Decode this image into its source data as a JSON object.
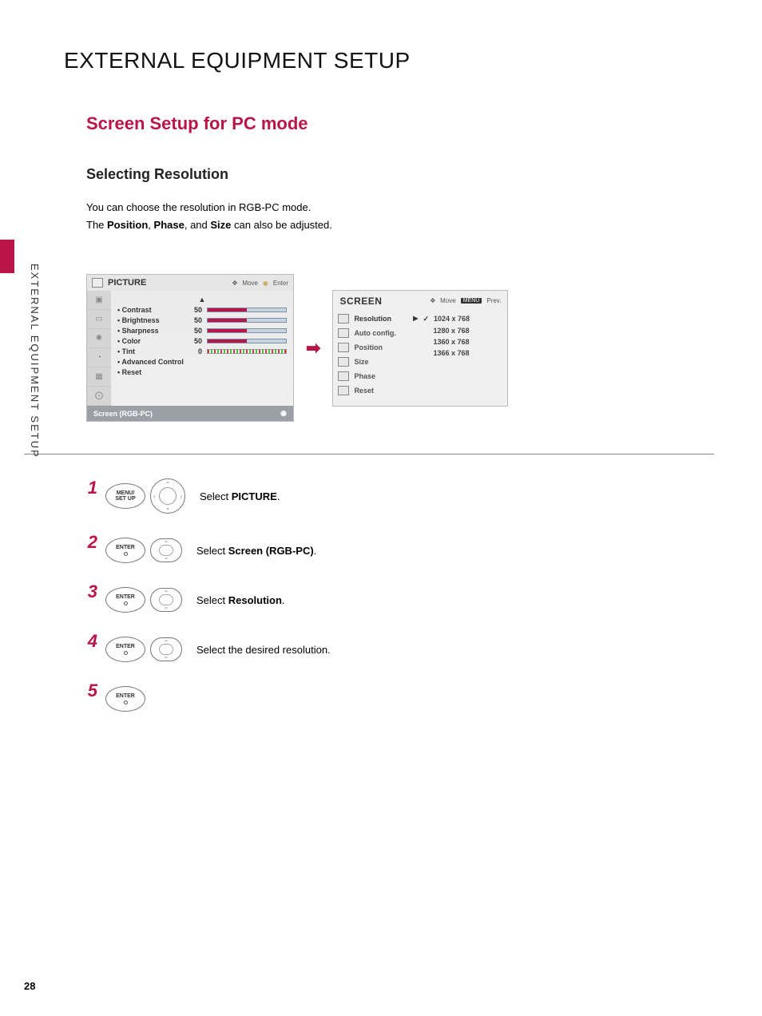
{
  "page": {
    "title": "EXTERNAL EQUIPMENT SETUP",
    "side_label": "EXTERNAL EQUIPMENT SETUP",
    "page_number": "28"
  },
  "section": {
    "subtitle": "Screen Setup for PC mode",
    "subsub": "Selecting Resolution",
    "intro_line1": "You can choose the resolution in RGB-PC mode.",
    "intro_line2_pre": "The ",
    "intro_bold1": "Position",
    "intro_mid": ", ",
    "intro_bold2": "Phase",
    "intro_and": ", and ",
    "intro_bold3": "Size",
    "intro_line2_post": " can also be adjusted."
  },
  "picture_panel": {
    "title": "PICTURE",
    "hint_move": "Move",
    "hint_enter": "Enter",
    "rows": [
      {
        "label": "• Contrast",
        "value": "50",
        "fill": 50
      },
      {
        "label": "• Brightness",
        "value": "50",
        "fill": 50
      },
      {
        "label": "• Sharpness",
        "value": "50",
        "fill": 50
      },
      {
        "label": "• Color",
        "value": "50",
        "fill": 50
      }
    ],
    "tint_label": "• Tint",
    "tint_value": "0",
    "adv_label": "• Advanced Control",
    "reset_label": "• Reset",
    "footer_label": "Screen (RGB-PC)",
    "footer_icon": "◉"
  },
  "screen_panel": {
    "title": "SCREEN",
    "hint_move": "Move",
    "hint_prev_tag": "MENU",
    "hint_prev": "Prev.",
    "items": [
      {
        "label": "Resolution",
        "selected": true
      },
      {
        "label": "Auto config."
      },
      {
        "label": "Position"
      },
      {
        "label": "Size"
      },
      {
        "label": "Phase"
      },
      {
        "label": "Reset"
      }
    ],
    "resolutions": [
      {
        "label": "1024 x 768",
        "checked": true
      },
      {
        "label": "1280 x 768"
      },
      {
        "label": "1360 x 768"
      },
      {
        "label": "1366 x 768"
      }
    ]
  },
  "steps": {
    "s1_num": "1",
    "s1_btn_line1": "MENU/",
    "s1_btn_line2": "SET UP",
    "s1_pre": "Select ",
    "s1_bold": "PICTURE",
    "s1_post": ".",
    "s2_num": "2",
    "s2_btn": "ENTER",
    "s2_pre": "Select ",
    "s2_bold": "Screen (RGB-PC)",
    "s2_post": ".",
    "s3_num": "3",
    "s3_btn": "ENTER",
    "s3_pre": "Select ",
    "s3_bold": "Resolution",
    "s3_post": ".",
    "s4_num": "4",
    "s4_btn": "ENTER",
    "s4_text": "Select the desired resolution.",
    "s5_num": "5",
    "s5_btn": "ENTER"
  }
}
